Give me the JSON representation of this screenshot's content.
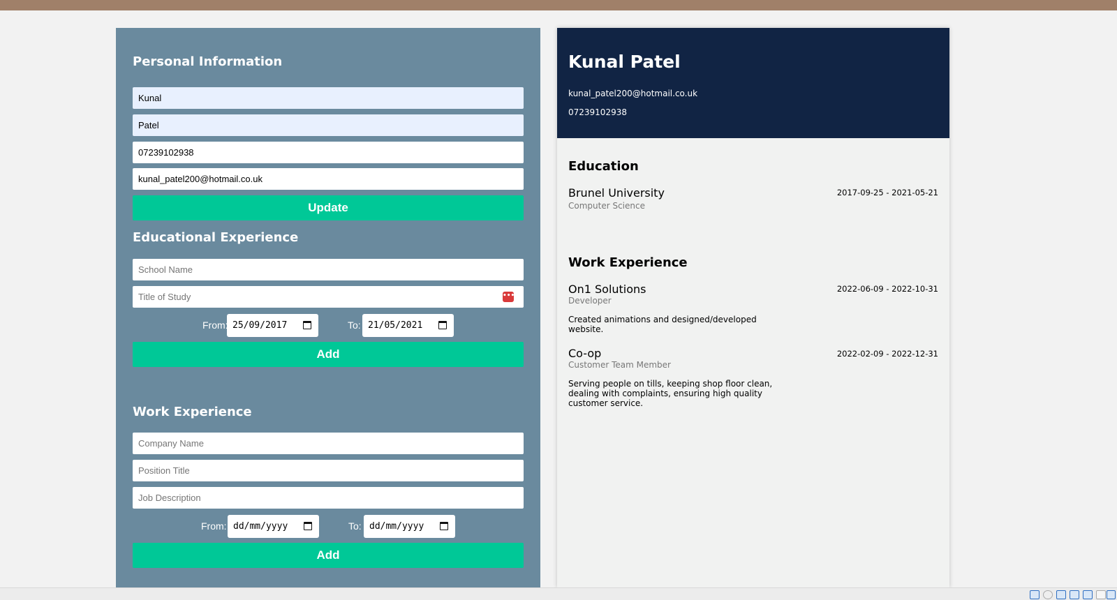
{
  "form": {
    "personal": {
      "heading": "Personal Information",
      "first_name": "Kunal",
      "last_name": "Patel",
      "phone": "07239102938",
      "email": "kunal_patel200@hotmail.co.uk",
      "update_label": "Update"
    },
    "education": {
      "heading": "Educational Experience",
      "school_placeholder": "School Name",
      "study_placeholder": "Title of Study",
      "from_label": "From:",
      "from_value": "25/09/2017",
      "to_label": "To:",
      "to_value": "21/05/2021",
      "add_label": "Add"
    },
    "work": {
      "heading": "Work Experience",
      "company_placeholder": "Company Name",
      "position_placeholder": "Position Title",
      "description_placeholder": "Job Description",
      "from_label": "From:",
      "from_value": "dd/mm/yyyy",
      "to_label": "To:",
      "to_value": "dd/mm/yyyy",
      "add_label": "Add"
    }
  },
  "cv": {
    "name": "Kunal Patel",
    "email": "kunal_patel200@hotmail.co.uk",
    "phone": "07239102938",
    "education": {
      "heading": "Education",
      "entries": [
        {
          "school": "Brunel University",
          "study": "Computer Science",
          "dates": "2017-09-25 - 2021-05-21"
        }
      ]
    },
    "work": {
      "heading": "Work Experience",
      "entries": [
        {
          "company": "On1 Solutions",
          "position": "Developer",
          "dates": "2022-06-09 - 2022-10-31",
          "description": "Created animations and designed/developed website."
        },
        {
          "company": "Co-op",
          "position": "Customer Team Member",
          "dates": "2022-02-09 - 2022-12-31",
          "description": "Serving people on tills, keeping shop floor clean, dealing with complaints, ensuring high quality customer service."
        }
      ]
    }
  },
  "icons": {
    "autofill_icon": "password-manager-icon",
    "date_picker_icon": "calendar-icon"
  },
  "colors": {
    "form_bg": "#6a8a9e",
    "accent": "#00c897",
    "cv_header_bg": "#112444",
    "top_bar": "#a08069"
  }
}
